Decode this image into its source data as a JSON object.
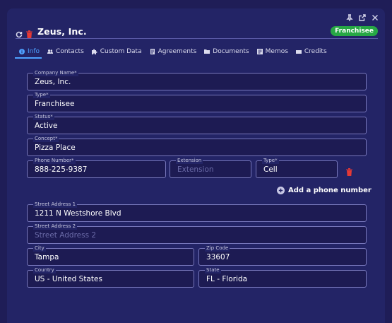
{
  "header": {
    "title": "Zeus, Inc.",
    "badge": "Franchisee",
    "badge_color": "#27a745",
    "icons": [
      "refresh-icon",
      "trash-icon"
    ]
  },
  "window_controls": [
    "pin-icon",
    "popout-icon",
    "close-icon"
  ],
  "tabs": [
    {
      "label": "Info",
      "icon": "info-icon",
      "active": true
    },
    {
      "label": "Contacts",
      "icon": "contacts-icon",
      "active": false
    },
    {
      "label": "Custom Data",
      "icon": "puzzle-icon",
      "active": false
    },
    {
      "label": "Agreements",
      "icon": "agreement-icon",
      "active": false
    },
    {
      "label": "Documents",
      "icon": "folder-icon",
      "active": false
    },
    {
      "label": "Memos",
      "icon": "memo-icon",
      "active": false
    },
    {
      "label": "Credits",
      "icon": "credits-icon",
      "active": false
    }
  ],
  "accent_color": "#4ea1ff",
  "form": {
    "company_name": {
      "label": "Company Name*",
      "value": "Zeus, Inc."
    },
    "type": {
      "label": "Type*",
      "value": "Franchisee"
    },
    "status": {
      "label": "Status*",
      "value": "Active"
    },
    "concept": {
      "label": "Concept*",
      "value": "Pizza Place"
    },
    "phone_number": {
      "label": "Phone Number*",
      "value": "888-225-9387"
    },
    "extension": {
      "label": "Extension",
      "placeholder": "Extension"
    },
    "phone_type": {
      "label": "Type*",
      "value": "Cell"
    },
    "add_phone_label": "Add a phone number",
    "street1": {
      "label": "Street Address 1",
      "value": "1211 N Westshore Blvd"
    },
    "street2": {
      "label": "Street Address 2",
      "placeholder": "Street Address 2"
    },
    "city": {
      "label": "City",
      "value": "Tampa"
    },
    "zip": {
      "label": "Zip Code",
      "value": "33607"
    },
    "country": {
      "label": "Country",
      "value": "US - United States"
    },
    "state": {
      "label": "State",
      "value": "FL - Florida"
    }
  }
}
